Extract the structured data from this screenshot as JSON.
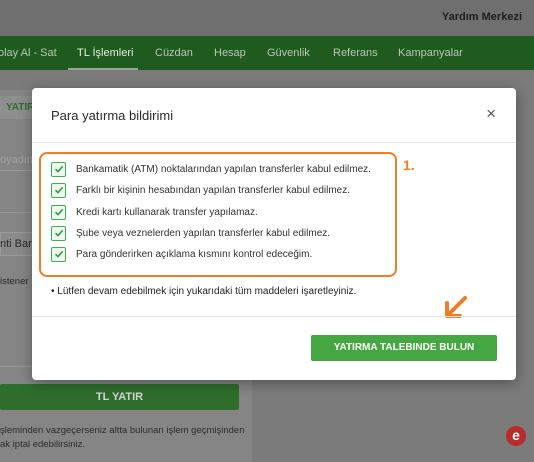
{
  "header": {
    "help_link": "Yardım Merkezi"
  },
  "nav": {
    "items": [
      {
        "label": "olay Al - Sat"
      },
      {
        "label": "TL İşlemleri"
      },
      {
        "label": "Cüzdan"
      },
      {
        "label": "Hesap"
      },
      {
        "label": "Güvenlik"
      },
      {
        "label": "Referans"
      },
      {
        "label": "Kampanyalar"
      }
    ]
  },
  "background": {
    "tab_label": "YATIR",
    "field1_fragment": "oyadın",
    "field2_fragment": "nti Ban",
    "field3_fragment": "istener",
    "tl_button": "TL YATIR",
    "footer_line1": "şleminden vazgeçerseniz altta bulunan işlem geçmişinden",
    "footer_line2": "ak iptal edebilirsiniz.",
    "brand_letter": "e"
  },
  "modal": {
    "title": "Para yatırma bildirimi",
    "close_symbol": "×",
    "step_label": "1.",
    "checks": [
      {
        "label": "Bankamatik (ATM) noktalarından yapılan transferler kabul edilmez.",
        "checked": true
      },
      {
        "label": "Farklı bir kişinin hesabından yapılan transferler kabul edilmez.",
        "checked": true
      },
      {
        "label": "Kredi kartı kullanarak transfer yapılamaz.",
        "checked": true
      },
      {
        "label": "Şube veya veznelerden yapılan transferler kabul edilmez.",
        "checked": true
      },
      {
        "label": "Para gönderirken açıklama kısmını kontrol edeceğim.",
        "checked": true
      }
    ],
    "note": "• Lütfen devam edebilmek için yukarıdaki tüm maddeleri işaretleyiniz.",
    "submit_button": "YATIRMA TALEBINDE BULUN"
  },
  "colors": {
    "nav_bg": "#1f5a1e",
    "accent_green": "#44a742",
    "highlight_orange": "#ef7d27"
  }
}
